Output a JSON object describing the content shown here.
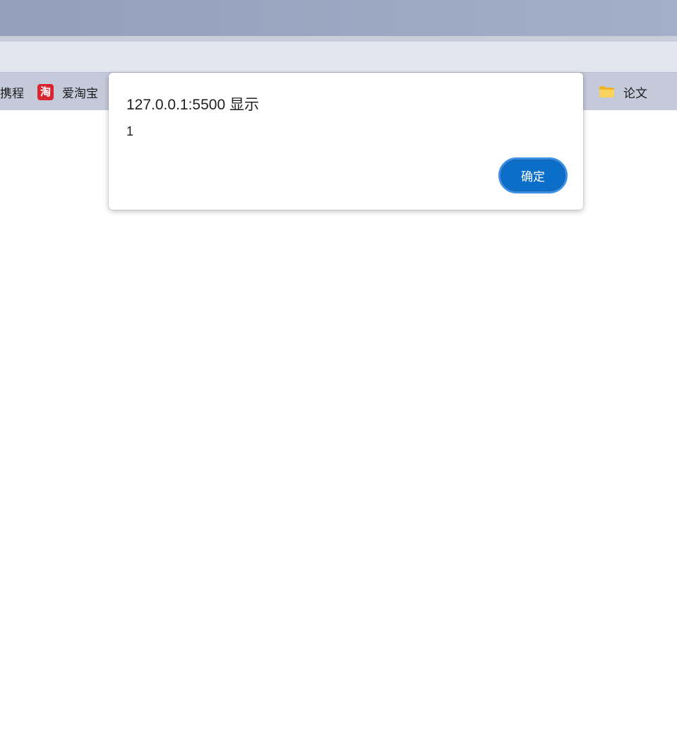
{
  "browser": {
    "bookmarks": [
      {
        "label": "携程",
        "icon": "bookmark-favicon-icon"
      },
      {
        "label": "爱淘宝",
        "icon": "taobao-icon",
        "icon_glyph": "淘",
        "icon_color": "#d9252f"
      },
      {
        "label": "论文",
        "icon": "folder-icon",
        "icon_color": "#f7c23a"
      }
    ]
  },
  "dialog": {
    "title": "127.0.0.1:5500 显示",
    "message": "1",
    "ok_label": "确定",
    "accent_color": "#0b6fc9"
  }
}
